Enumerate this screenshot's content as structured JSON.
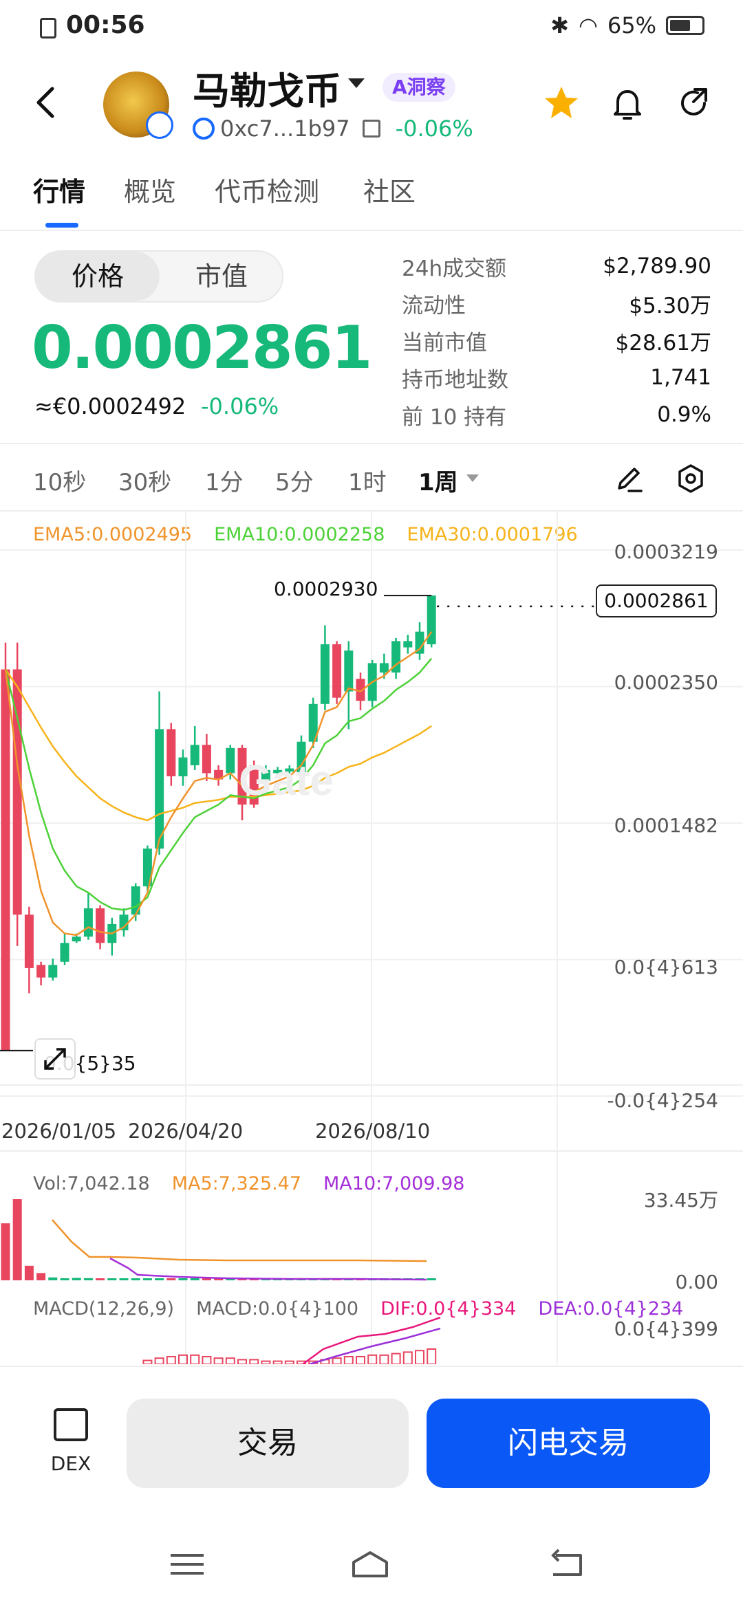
{
  "status_bar": {
    "time": "00:56",
    "battery": "65%",
    "battery_level": 0.65
  },
  "header": {
    "token_name": "马勒戈币",
    "insight_label": "A洞察",
    "address": "0xc7...1b97",
    "change": "-0.06%"
  },
  "tabs": [
    "行情",
    "概览",
    "代币检测",
    "社区"
  ],
  "price": {
    "segment": [
      "价格",
      "市值"
    ],
    "value": "0.0002861",
    "eur_value": "≈€0.0002492",
    "eur_change": "-0.06%"
  },
  "stats": [
    {
      "label": "24h成交额",
      "value": "$2,789.90"
    },
    {
      "label": "流动性",
      "value": "$5.30万"
    },
    {
      "label": "当前市值",
      "value": "$28.61万"
    },
    {
      "label": "持币地址数",
      "value": "1,741"
    },
    {
      "label": "前 10 持有",
      "value": "0.9%"
    }
  ],
  "intervals": [
    "10秒",
    "30秒",
    "1分",
    "5分",
    "1时",
    "1周"
  ],
  "chart": {
    "ema5": "EMA5:0.0002495",
    "ema10": "EMA10:0.0002258",
    "ema30": "EMA30:0.0001796",
    "y_labels": [
      "0.0003219",
      "0.0002350",
      "0.0001482",
      "0.0{4}613",
      "-0.0{4}254"
    ],
    "high_label": "0.0002930",
    "low_label": "0.0{5}35",
    "current_label": "0.0002861",
    "dates": [
      "2026/01/05",
      "2026/04/20",
      "2026/08/10"
    ],
    "vol": "Vol:7,042.18",
    "vol_ma5": "MA5:7,325.47",
    "vol_ma10": "MA10:7,009.98",
    "vol_max": "33.45万",
    "vol_min": "0.00",
    "macd_title": "MACD(12,26,9)",
    "macd": "MACD:0.0{4}100",
    "dif": "DIF:0.0{4}334",
    "dea": "DEA:0.0{4}234",
    "macd_max": "0.0{4}399",
    "colors": {
      "up": "#16b979",
      "down": "#e8455f",
      "ema5": "#f0932b",
      "ema10": "#4cd137",
      "ema30": "#f6b31a",
      "ma10": "#a42fd8",
      "dif": "#e8177b",
      "dea": "#9b30d9"
    }
  },
  "chart_data": {
    "type": "candlestick",
    "y_range": [
      -2.54e-05,
      0.0003219
    ],
    "candles": [
      {
        "o": 0.000246,
        "c": 3.5e-06,
        "h": 0.000263,
        "l": 3.5e-06
      },
      {
        "o": 0.000246,
        "c": 9e-05,
        "h": 0.000263,
        "l": 7e-05
      },
      {
        "o": 9e-05,
        "c": 5.6e-05,
        "h": 9.5e-05,
        "l": 4e-05
      },
      {
        "o": 5.8e-05,
        "c": 5e-05,
        "h": 6e-05,
        "l": 4.5e-05
      },
      {
        "o": 5e-05,
        "c": 5.8e-05,
        "h": 6.2e-05,
        "l": 4.8e-05
      },
      {
        "o": 6e-05,
        "c": 7.2e-05,
        "h": 7.8e-05,
        "l": 5.8e-05
      },
      {
        "o": 7.3e-05,
        "c": 7.6e-05,
        "h": 7.8e-05,
        "l": 7.2e-05
      },
      {
        "o": 7.6e-05,
        "c": 9.4e-05,
        "h": 0.000104,
        "l": 7.4e-05
      },
      {
        "o": 9.4e-05,
        "c": 7.2e-05,
        "h": 9.6e-05,
        "l": 6.8e-05
      },
      {
        "o": 7.2e-05,
        "c": 8.4e-05,
        "h": 8.8e-05,
        "l": 6.4e-05
      },
      {
        "o": 8e-05,
        "c": 9e-05,
        "h": 9.4e-05,
        "l": 7.6e-05
      },
      {
        "o": 9e-05,
        "c": 0.000108,
        "h": 0.00011,
        "l": 8.6e-05
      },
      {
        "o": 0.000108,
        "c": 0.000132,
        "h": 0.000134,
        "l": 0.000104
      },
      {
        "o": 0.000132,
        "c": 0.000208,
        "h": 0.000232,
        "l": 0.000128
      },
      {
        "o": 0.000208,
        "c": 0.000178,
        "h": 0.000212,
        "l": 0.000172
      },
      {
        "o": 0.000178,
        "c": 0.00019,
        "h": 0.000195,
        "l": 0.000172
      },
      {
        "o": 0.000185,
        "c": 0.000198,
        "h": 0.00021,
        "l": 0.000182
      },
      {
        "o": 0.000198,
        "c": 0.00018,
        "h": 0.000205,
        "l": 0.000175
      },
      {
        "o": 0.000182,
        "c": 0.000176,
        "h": 0.000185,
        "l": 0.000172
      },
      {
        "o": 0.00018,
        "c": 0.000196,
        "h": 0.000198,
        "l": 0.000176
      },
      {
        "o": 0.000196,
        "c": 0.00016,
        "h": 0.000198,
        "l": 0.00015
      },
      {
        "o": 0.000185,
        "c": 0.00016,
        "h": 0.000188,
        "l": 0.000158
      },
      {
        "o": 0.000175,
        "c": 0.000182,
        "h": 0.000185,
        "l": 0.000172
      },
      {
        "o": 0.00018,
        "c": 0.000182,
        "h": 0.000184,
        "l": 0.000178
      },
      {
        "o": 0.000181,
        "c": 0.000183,
        "h": 0.000185,
        "l": 0.000179
      },
      {
        "o": 0.00018,
        "c": 0.0002,
        "h": 0.000204,
        "l": 0.000178
      },
      {
        "o": 0.0002,
        "c": 0.000224,
        "h": 0.000228,
        "l": 0.000196
      },
      {
        "o": 0.000224,
        "c": 0.000262,
        "h": 0.000274,
        "l": 0.00022
      },
      {
        "o": 0.000262,
        "c": 0.000228,
        "h": 0.000264,
        "l": 0.000224
      },
      {
        "o": 0.000232,
        "c": 0.000258,
        "h": 0.000264,
        "l": 0.000208
      },
      {
        "o": 0.00024,
        "c": 0.000226,
        "h": 0.000244,
        "l": 0.00022
      },
      {
        "o": 0.000226,
        "c": 0.00025,
        "h": 0.000252,
        "l": 0.000222
      },
      {
        "o": 0.000244,
        "c": 0.00025,
        "h": 0.000256,
        "l": 0.00024
      },
      {
        "o": 0.000244,
        "c": 0.000264,
        "h": 0.000266,
        "l": 0.00024
      },
      {
        "o": 0.00026,
        "c": 0.000264,
        "h": 0.000268,
        "l": 0.000256
      },
      {
        "o": 0.000256,
        "c": 0.00027,
        "h": 0.000276,
        "l": 0.000252
      },
      {
        "o": 0.000262,
        "c": 0.000293,
        "h": 0.000293,
        "l": 0.00026
      }
    ],
    "ema5": [
      0.000246,
      0.000185,
      0.00014,
      0.000105,
      8.5e-05,
      7.8e-05,
      7.7e-05,
      8.2e-05,
      7.9e-05,
      7.8e-05,
      8.2e-05,
      9e-05,
      0.000104,
      0.000138,
      0.000152,
      0.000164,
      0.000175,
      0.000177,
      0.000176,
      0.00018,
      0.000172,
      0.000168,
      0.000172,
      0.000175,
      0.000178,
      0.000185,
      0.000198,
      0.000219,
      0.000222,
      0.000234,
      0.000232,
      0.000238,
      0.000242,
      0.000249,
      0.000254,
      0.000259,
      0.00027
    ],
    "ema10": [
      0.000246,
      0.000215,
      0.000183,
      0.000155,
      0.000132,
      0.000118,
      0.000108,
      0.000104,
      9.8e-05,
      9.4e-05,
      9.3e-05,
      9.5e-05,
      0.000101,
      0.00012,
      0.000131,
      0.000142,
      0.000152,
      0.000156,
      0.00016,
      0.000166,
      0.000165,
      0.000164,
      0.000167,
      0.000169,
      0.000171,
      0.000176,
      0.000185,
      0.000199,
      0.000204,
      0.000213,
      0.000215,
      0.000221,
      0.000226,
      0.000233,
      0.000238,
      0.000244,
      0.000253
    ],
    "ema30": [
      0.000246,
      0.000235,
      0.000222,
      0.000209,
      0.000197,
      0.000187,
      0.000178,
      0.000171,
      0.000164,
      0.000159,
      0.000155,
      0.000152,
      0.00015,
      0.000154,
      0.000156,
      0.000158,
      0.000161,
      0.000162,
      0.000163,
      0.000165,
      0.000165,
      0.000165,
      0.000166,
      0.000167,
      0.000168,
      0.000169,
      0.000172,
      0.000177,
      0.00018,
      0.000184,
      0.000186,
      0.00019,
      0.000193,
      0.000197,
      0.000201,
      0.000205,
      0.00021
    ],
    "volume": [
      235000,
      334500,
      60000,
      30000,
      12000,
      8000,
      10000,
      9000,
      6000,
      7000,
      5000,
      4000,
      5000,
      6000,
      3000,
      4000,
      3000,
      3000,
      3000,
      4000,
      3000,
      3000,
      2000,
      2000,
      2000,
      3000,
      3000,
      4000,
      3000,
      3000,
      2000,
      3000,
      2000,
      3000,
      2000,
      3000,
      7042
    ],
    "macd_hist": [
      0,
      0,
      0,
      0,
      0,
      0,
      0,
      0,
      0,
      0,
      0,
      0,
      2.5e-06,
      4e-06,
      5e-06,
      6e-06,
      6e-06,
      5e-06,
      4e-06,
      4e-06,
      3e-06,
      3e-06,
      2e-06,
      2e-06,
      2e-06,
      2e-06,
      2e-06,
      3e-06,
      4e-06,
      5e-06,
      5e-06,
      6e-06,
      6e-06,
      7e-06,
      8e-06,
      9e-06,
      1e-05
    ]
  }
}
